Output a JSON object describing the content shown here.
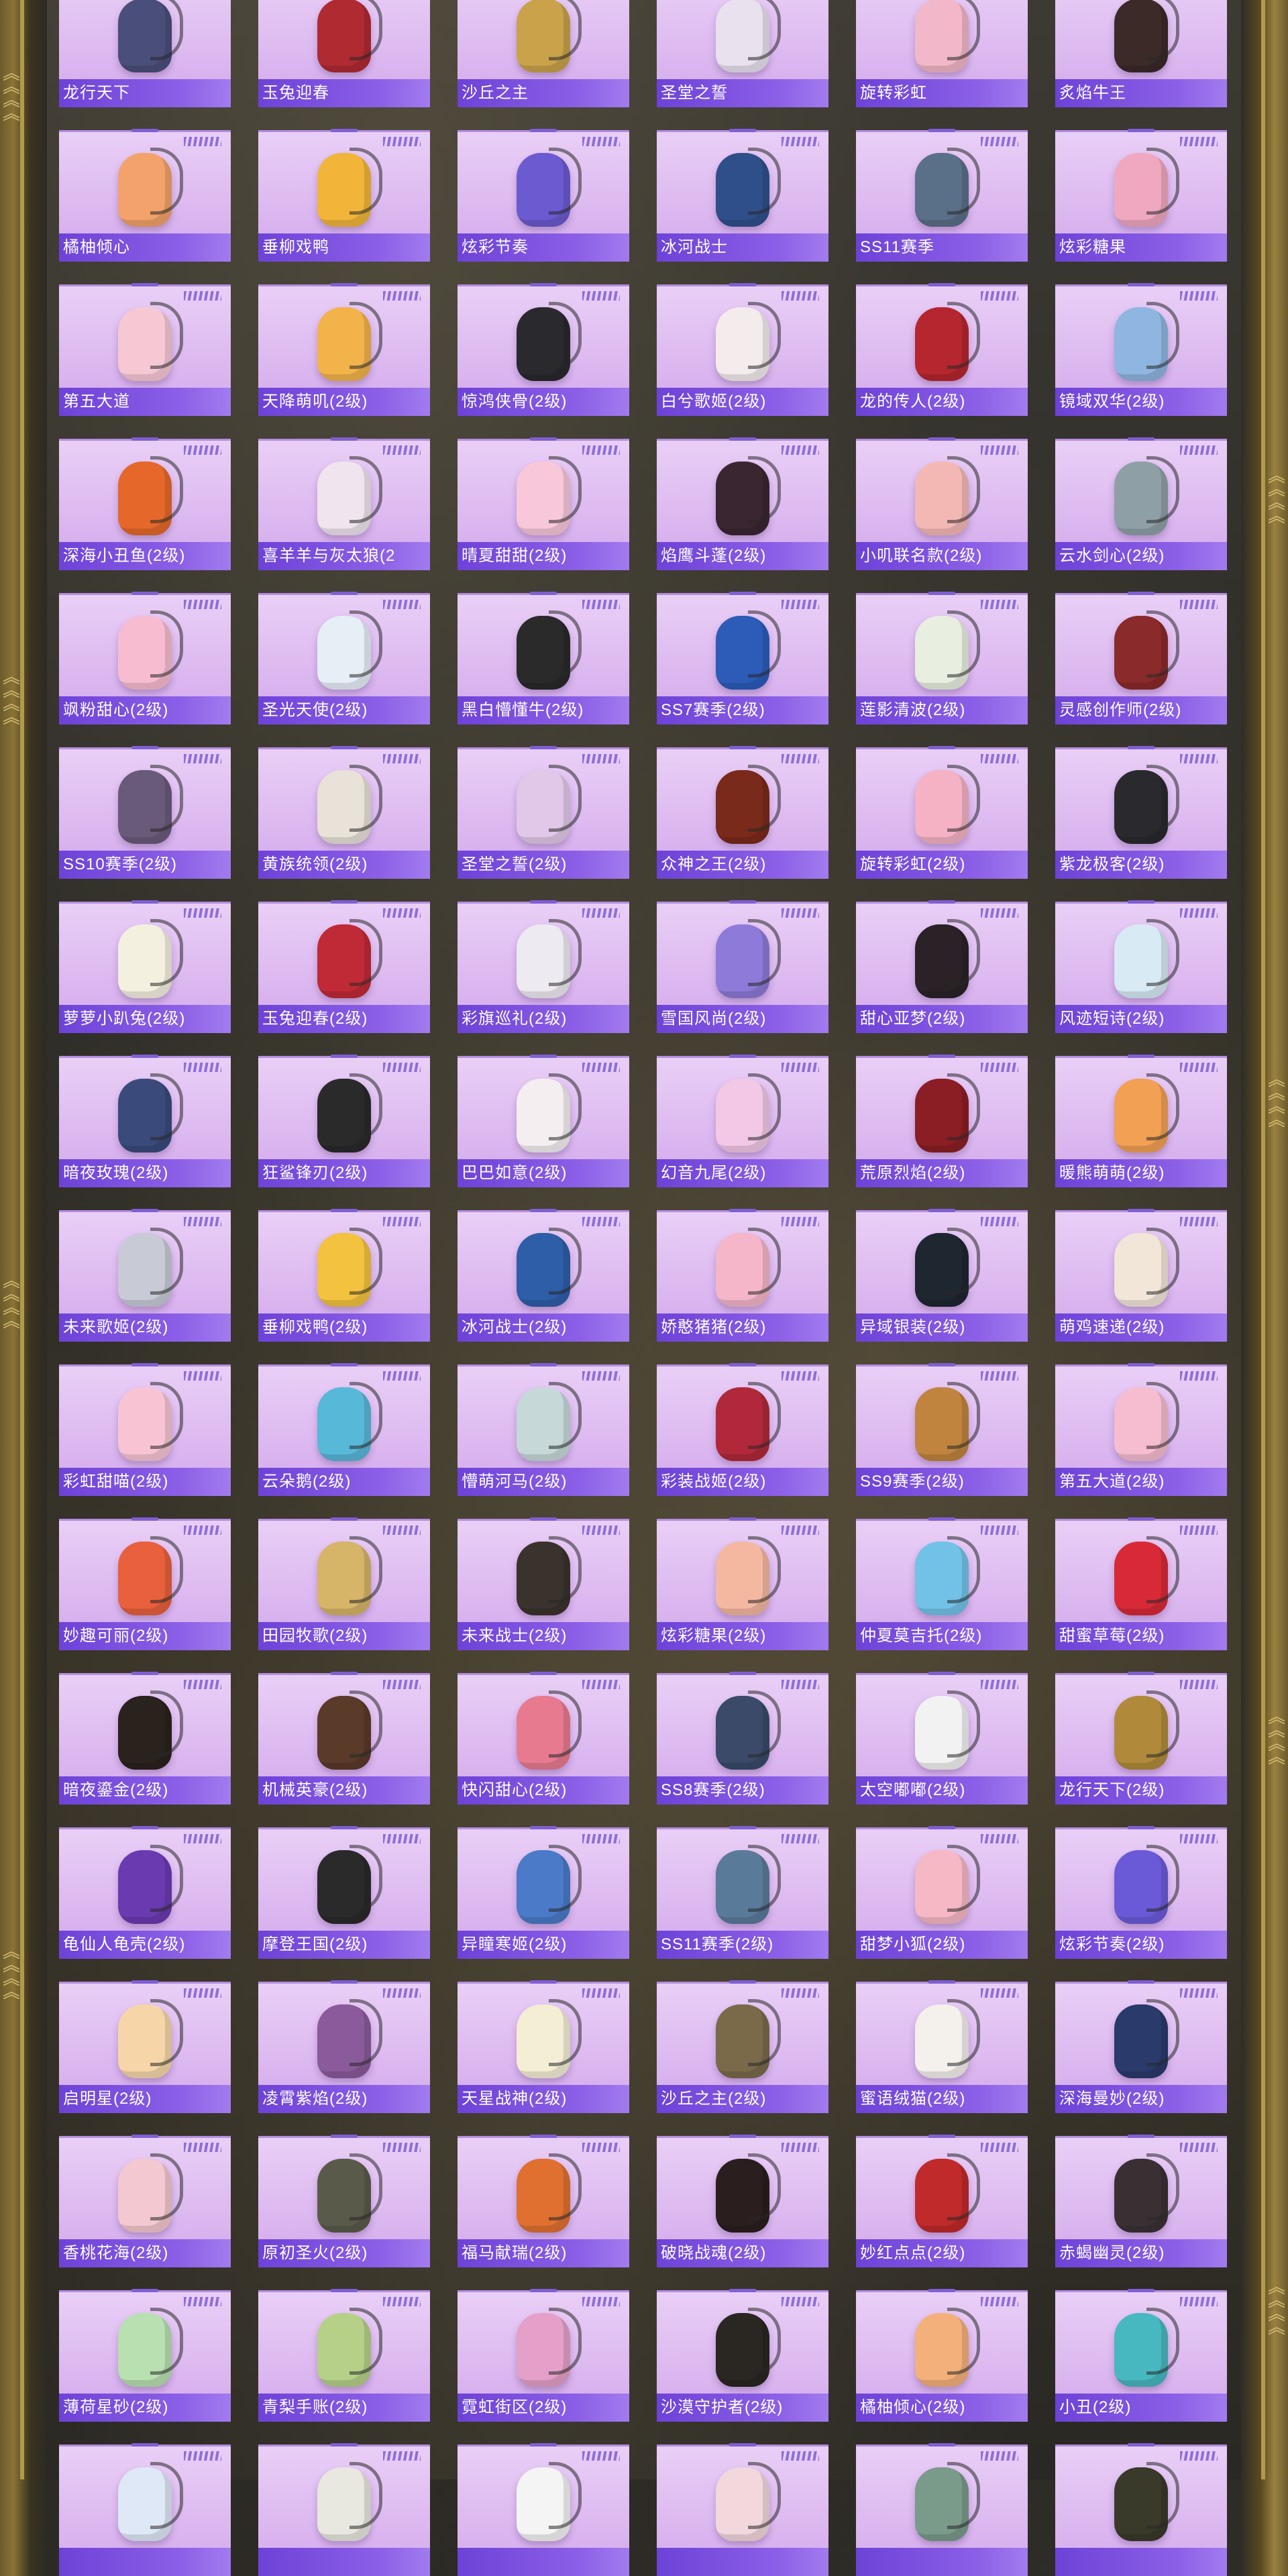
{
  "rows": [
    [
      "龙行天下",
      "玉兔迎春",
      "沙丘之主",
      "圣堂之誓",
      "旋转彩虹",
      "炙焰牛王"
    ],
    [
      "橘柚倾心",
      "垂柳戏鸭",
      "炫彩节奏",
      "冰河战士",
      "SS11赛季",
      "炫彩糖果"
    ],
    [
      "第五大道",
      "天降萌叽(2级)",
      "惊鸿侠骨(2级)",
      "白兮歌姬(2级)",
      "龙的传人(2级)",
      "镜域双华(2级)"
    ],
    [
      "深海小丑鱼(2级)",
      "喜羊羊与灰太狼(2",
      "晴夏甜甜(2级)",
      "焰鹰斗蓬(2级)",
      "小叽联名款(2级)",
      "云水剑心(2级)"
    ],
    [
      "飒粉甜心(2级)",
      "圣光天使(2级)",
      "黑白懵懂牛(2级)",
      "SS7赛季(2级)",
      "莲影清波(2级)",
      "灵感创作师(2级)"
    ],
    [
      "SS10赛季(2级)",
      "黄族统领(2级)",
      "圣堂之誓(2级)",
      "众神之王(2级)",
      "旋转彩虹(2级)",
      "紫龙极客(2级)"
    ],
    [
      "萝萝小趴兔(2级)",
      "玉兔迎春(2级)",
      "彩旗巡礼(2级)",
      "雪国风尚(2级)",
      "甜心亚梦(2级)",
      "风迹短诗(2级)"
    ],
    [
      "暗夜玫瑰(2级)",
      "狂鲨锋刃(2级)",
      "巴巴如意(2级)",
      "幻音九尾(2级)",
      "荒原烈焰(2级)",
      "暖熊萌萌(2级)"
    ],
    [
      "未来歌姬(2级)",
      "垂柳戏鸭(2级)",
      "冰河战士(2级)",
      "娇憨猪猪(2级)",
      "异域银装(2级)",
      "萌鸡速递(2级)"
    ],
    [
      "彩虹甜喵(2级)",
      "云朵鹅(2级)",
      "懵萌河马(2级)",
      "彩装战姬(2级)",
      "SS9赛季(2级)",
      "第五大道(2级)"
    ],
    [
      "妙趣可丽(2级)",
      "田园牧歌(2级)",
      "未来战士(2级)",
      "炫彩糖果(2级)",
      "仲夏莫吉托(2级)",
      "甜蜜草莓(2级)"
    ],
    [
      "暗夜鎏金(2级)",
      "机械英豪(2级)",
      "快闪甜心(2级)",
      "SS8赛季(2级)",
      "太空嘟嘟(2级)",
      "龙行天下(2级)"
    ],
    [
      "龟仙人龟壳(2级)",
      "摩登王国(2级)",
      "异瞳寒姬(2级)",
      "SS11赛季(2级)",
      "甜梦小狐(2级)",
      "炫彩节奏(2级)"
    ],
    [
      "启明星(2级)",
      "凌霄紫焰(2级)",
      "天星战神(2级)",
      "沙丘之主(2级)",
      "蜜语绒猫(2级)",
      "深海曼妙(2级)"
    ],
    [
      "香桃花海(2级)",
      "原初圣火(2级)",
      "福马献瑞(2级)",
      "破晓战魂(2级)",
      "妙红点点(2级)",
      "赤蝎幽灵(2级)"
    ],
    [
      "薄荷星砂(2级)",
      "青梨手账(2级)",
      "霓虹街区(2级)",
      "沙漠守护者(2级)",
      "橘柚倾心(2级)",
      "小丑(2级)"
    ],
    [
      "",
      "",
      "",
      "",
      "",
      ""
    ]
  ],
  "item_colors": [
    [
      "#4a4e7a",
      "#b02a32",
      "#c9a24a",
      "#e9e1ee",
      "#f2b7c8",
      "#3b2a28"
    ],
    [
      "#f2a26a",
      "#f1b53a",
      "#6b5ad0",
      "#2f4f8a",
      "#5a6f88",
      "#f0a8c0"
    ],
    [
      "#f6c8d4",
      "#f2b34a",
      "#2a2a2e",
      "#f4ecec",
      "#b5262e",
      "#8fb6e0"
    ],
    [
      "#e5682a",
      "#f0e4ee",
      "#f8c8da",
      "#3a2630",
      "#f4b8b4",
      "#8ea0a6"
    ],
    [
      "#f8bcd0",
      "#e6eef6",
      "#2a2a2a",
      "#2c5cb8",
      "#e8efe0",
      "#8a2a2a"
    ],
    [
      "#6a5a7a",
      "#e8e2d8",
      "#e2c8e8",
      "#7a2a1a",
      "#f4b2c4",
      "#2a2a2e"
    ],
    [
      "#f4f0e0",
      "#c02a36",
      "#eeeaf2",
      "#8e7ad8",
      "#2a2226",
      "#d8eaf4"
    ],
    [
      "#3a4a7a",
      "#2a2a2a",
      "#f4eef0",
      "#f2c8e6",
      "#8a1e24",
      "#f2a054"
    ],
    [
      "#c8cad6",
      "#f3c23e",
      "#2e5ea8",
      "#f4b6c8",
      "#1e2630",
      "#f2e6d8"
    ],
    [
      "#f8c4d4",
      "#58b8d8",
      "#c6d8d8",
      "#b0283a",
      "#c0843e",
      "#f6bcd0"
    ],
    [
      "#e8603c",
      "#d6b468",
      "#3a322c",
      "#f4b8a0",
      "#72c2e8",
      "#d82a36"
    ],
    [
      "#2a221c",
      "#5a3a28",
      "#e87a90",
      "#3a4a68",
      "#f2f2f2",
      "#b08a3a"
    ],
    [
      "#6a3ab0",
      "#2a2a2a",
      "#4a7ac8",
      "#5a7a9a",
      "#f6b8c4",
      "#6a5ad8"
    ],
    [
      "#f6d6a8",
      "#8a5a9a",
      "#f4eed4",
      "#7a6a4a",
      "#f4f0ec",
      "#2a3a6a"
    ],
    [
      "#f4c8d0",
      "#5a5a4a",
      "#e07030",
      "#2a1e1e",
      "#c02a2a",
      "#3a3034"
    ],
    [
      "#b8e0b0",
      "#b6d088",
      "#e4a0c8",
      "#2a2622",
      "#f4b07a",
      "#48b8c0"
    ],
    [
      "#dfe8f6",
      "#e8e8e0",
      "#f4f4f4",
      "#f2d8dc",
      "#7a9a8a",
      "#3a3a2a"
    ]
  ]
}
